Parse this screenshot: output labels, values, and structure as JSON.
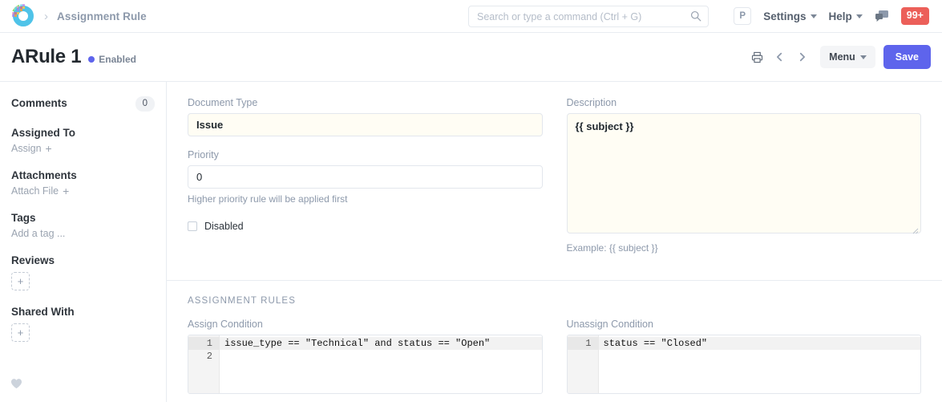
{
  "navbar": {
    "logo_icon": "frappe-logo-icon",
    "breadcrumb_separator": "›",
    "breadcrumb": "Assignment Rule",
    "search": {
      "placeholder": "Search or type a command (Ctrl + G)",
      "value": "",
      "icon": "search-icon"
    },
    "avatar_initial": "P",
    "settings_label": "Settings",
    "help_label": "Help",
    "chat_icon": "chat-bubble-icon",
    "notification_badge": "99+",
    "badge_color": "#ec5f59"
  },
  "page_header": {
    "title": "ARule 1",
    "status": "Enabled",
    "status_dot_color": "#5e64ec",
    "print_icon": "printer-icon",
    "prev_icon": "chevron-left-icon",
    "next_icon": "chevron-right-icon",
    "menu_label": "Menu",
    "save_label": "Save",
    "save_color": "#5e64ec"
  },
  "sidebar": {
    "comments_label": "Comments",
    "comments_count": "0",
    "assigned_to_label": "Assigned To",
    "assign_label": "Assign",
    "assign_plus": "+",
    "attachments_label": "Attachments",
    "attach_file_label": "Attach File",
    "attach_plus": "+",
    "tags_label": "Tags",
    "add_tag_label": "Add a tag ...",
    "reviews_label": "Reviews",
    "reviews_add": "+",
    "shared_with_label": "Shared With",
    "shared_add": "+",
    "like_icon": "heart-icon"
  },
  "form": {
    "document_type": {
      "label": "Document Type",
      "value": "Issue"
    },
    "priority": {
      "label": "Priority",
      "value": "0",
      "hint": "Higher priority rule will be applied first"
    },
    "disabled": {
      "label": "Disabled",
      "checked": false
    },
    "description": {
      "label": "Description",
      "value": "{{ subject }}",
      "hint": "Example: {{ subject }}"
    }
  },
  "assignment_rules": {
    "section_title": "ASSIGNMENT RULES",
    "assign_condition": {
      "label": "Assign Condition",
      "lines": [
        "issue_type == \"Technical\" and status == \"Open\"",
        ""
      ],
      "line_numbers": [
        "1",
        "2"
      ]
    },
    "unassign_condition": {
      "label": "Unassign Condition",
      "lines": [
        "status == \"Closed\""
      ],
      "line_numbers": [
        "1"
      ]
    }
  }
}
